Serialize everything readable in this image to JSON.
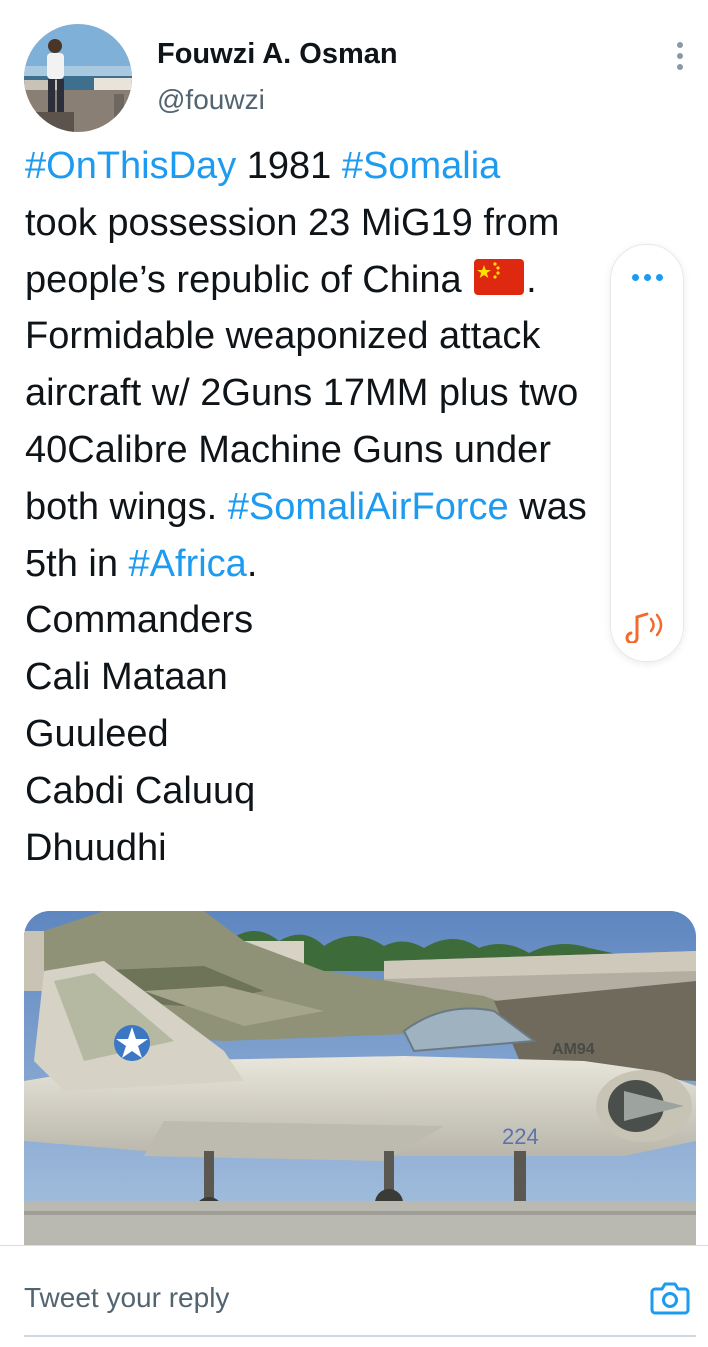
{
  "author": {
    "name": "Fouwzi A. Osman",
    "handle": "@fouwzi"
  },
  "tweet": {
    "line1": {
      "tag1": "#OnThisDay",
      "text1": " 1981 ",
      "tag2": "#Somalia"
    },
    "line2": "took possession 23 MiG19 from",
    "line3": {
      "text": "people’s republic of China ",
      "flag_icon": "china-flag-emoji",
      "after": "."
    },
    "line4": "Formidable weaponized attack",
    "line5": "aircraft w/ 2Guns 17MM plus two",
    "line6": "40Calibre Machine Guns under",
    "line7": {
      "text1": "both wings. ",
      "tag": "#SomaliAirForce",
      "text2": " was"
    },
    "line8": {
      "text1": "5th in ",
      "tag": "#Africa",
      "text2": "."
    },
    "line9": "Commanders",
    "line10": "Cali Mataan",
    "line11": "Guuleed",
    "line12": "Cabdi Caluuq",
    "line13": "Dhuudhi"
  },
  "media": {
    "markings": {
      "fin_code": "AM94",
      "nose_number": "224"
    }
  },
  "reply": {
    "placeholder": "Tweet your reply"
  },
  "icons": {
    "more": "more-vertical-icon",
    "floating_more": "more-horizontal-icon",
    "audio": "audio-note-icon",
    "camera": "camera-icon"
  },
  "colors": {
    "hashtag": "#1d9bf0",
    "text": "#0f1419",
    "secondary": "#536471",
    "audio_icon": "#f26a2e"
  }
}
